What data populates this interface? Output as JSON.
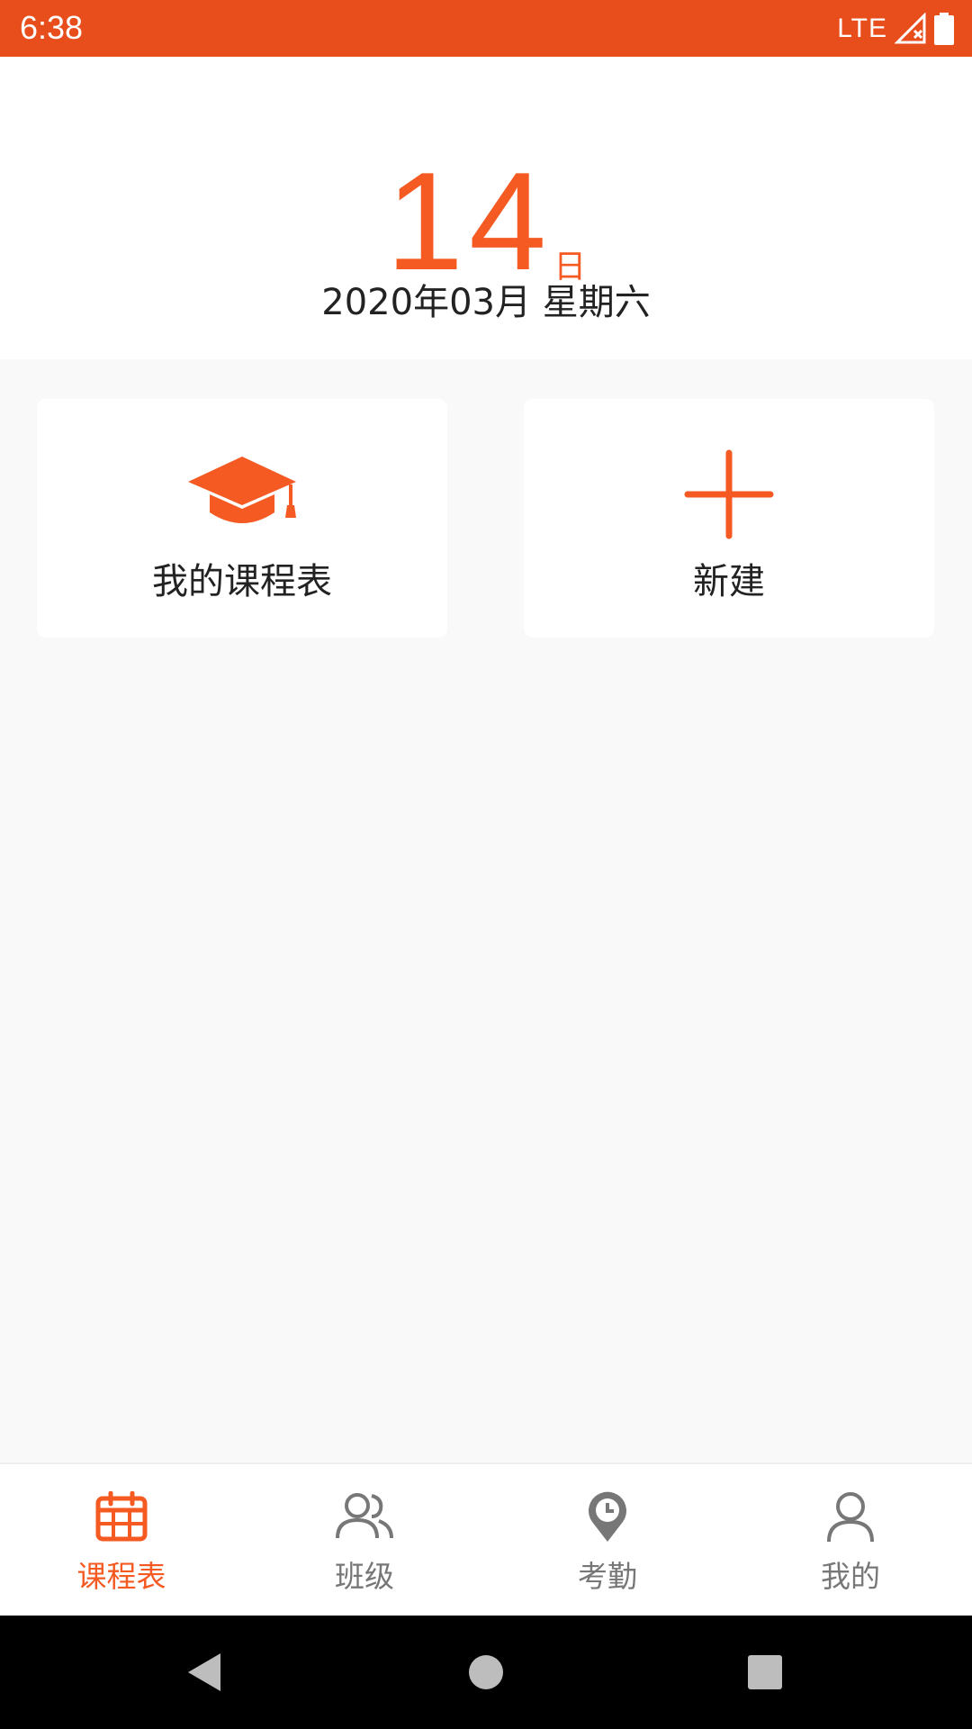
{
  "status_bar": {
    "time": "6:38",
    "network": "LTE"
  },
  "header": {
    "day": "14",
    "day_unit": "日",
    "year_month": "2020年03月",
    "weekday": "星期六"
  },
  "cards": {
    "mine_label": "我的课程表",
    "new_label": "新建"
  },
  "tabs": [
    {
      "label": "课程表",
      "icon": "calendar-icon",
      "active": true
    },
    {
      "label": "班级",
      "icon": "group-icon",
      "active": false
    },
    {
      "label": "考勤",
      "icon": "location-clock-icon",
      "active": false
    },
    {
      "label": "我的",
      "icon": "person-icon",
      "active": false
    }
  ],
  "colors": {
    "status_bar": "#e84e1b",
    "accent": "#f45a22",
    "inactive": "#777777",
    "background": "#f9f9f9"
  }
}
